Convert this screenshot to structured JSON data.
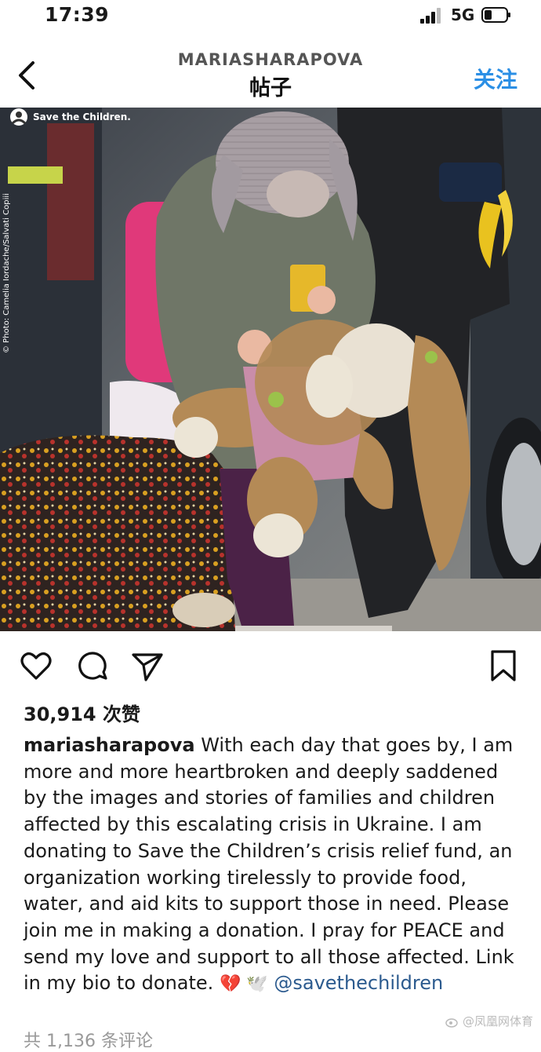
{
  "status_bar": {
    "time": "17:39",
    "network": "5G"
  },
  "header": {
    "username": "MARIASHARAPOVA",
    "title": "帖子",
    "follow_label": "关注",
    "back_icon": "chevron-left-icon"
  },
  "post_image": {
    "logo_text": "Save the Children.",
    "photo_credit": "© Photo: Camelia Iordache/Salvati Copiii"
  },
  "actions": {
    "like_icon": "heart-icon",
    "comment_icon": "comment-icon",
    "share_icon": "send-icon",
    "save_icon": "bookmark-icon"
  },
  "likes": "30,914 次赞",
  "caption": {
    "username": "mariasharapova",
    "text": " With each day that goes by, I am more and more heartbroken and deeply saddened by the images and stories of families and children affected by this escalating crisis in Ukraine. I am donating to Save the Children’s crisis relief fund, an organization working tirelessly to provide food, water, and aid kits to support those in need. Please join me in making a donation. I pray for PEACE and send my love and support to all those affected. Link in my bio to donate. ",
    "emojis": "💔 🕊️",
    "mention": "@savethechildren"
  },
  "comments_link": "共 1,136 条评论",
  "site_watermark": "@凤凰网体育",
  "colors": {
    "accent_blue": "#2b8fe5",
    "mention_blue": "#2b5a8e"
  }
}
